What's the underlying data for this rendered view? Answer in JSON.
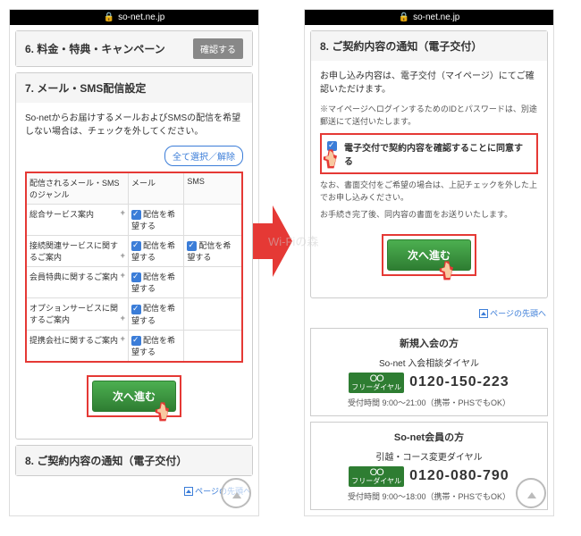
{
  "url": "so-net.ne.jp",
  "left": {
    "sec6": {
      "title": "6. 料金・特典・キャンペーン",
      "confirm": "確認する"
    },
    "sec7": {
      "title": "7. メール・SMS配信設定",
      "desc": "So-netからお届けするメールおよびSMSの配信を希望しない場合は、チェックを外してください。",
      "toggle": "全て選択／解除",
      "header": {
        "genre": "配信されるメール・SMSのジャンル",
        "mail": "メール",
        "sms": "SMS"
      },
      "opt_label": "配信を希望する",
      "rows": [
        {
          "name": "総合サービス案内",
          "mail": true,
          "sms": false
        },
        {
          "name": "接続関連サービスに関するご案内",
          "mail": true,
          "sms": true
        },
        {
          "name": "会員特典に関するご案内",
          "mail": true,
          "sms": false
        },
        {
          "name": "オプションサービスに関するご案内",
          "mail": true,
          "sms": false
        },
        {
          "name": "提携会社に関するご案内",
          "mail": true,
          "sms": false
        }
      ],
      "next": "次へ進む"
    },
    "sec8": {
      "title": "8. ご契約内容の通知（電子交付）"
    },
    "pagetop": "ページの先頭へ"
  },
  "right": {
    "sec8": {
      "title": "8. ご契約内容の通知（電子交付）",
      "p1": "お申し込み内容は、電子交付（マイページ）にてご確認いただけます。",
      "p2": "※マイページへログインするためのIDとパスワードは、別途郵送にて送付いたします。",
      "consent": "電子交付で契約内容を確認することに同意する",
      "p3": "なお、書面交付をご希望の場合は、上記チェックを外した上でお申し込みください。",
      "p4": "お手続き完了後、同内容の書面をお送りいたします。",
      "next": "次へ進む"
    },
    "pagetop": "ページの先頭へ",
    "contact_new": {
      "h": "新規入会の方",
      "sub": "So-net 入会相談ダイヤル",
      "tel": "0120-150-223",
      "hours": "受付時間 9:00〜21:00（携帯・PHSでもOK）"
    },
    "contact_member": {
      "h": "So-net会員の方",
      "sub": "引越・コース変更ダイヤル",
      "tel": "0120-080-790",
      "hours": "受付時間 9:00〜18:00（携帯・PHSでもOK）"
    },
    "freedial": "フリーダイヤル"
  },
  "watermark": "Wi-Fiの森"
}
